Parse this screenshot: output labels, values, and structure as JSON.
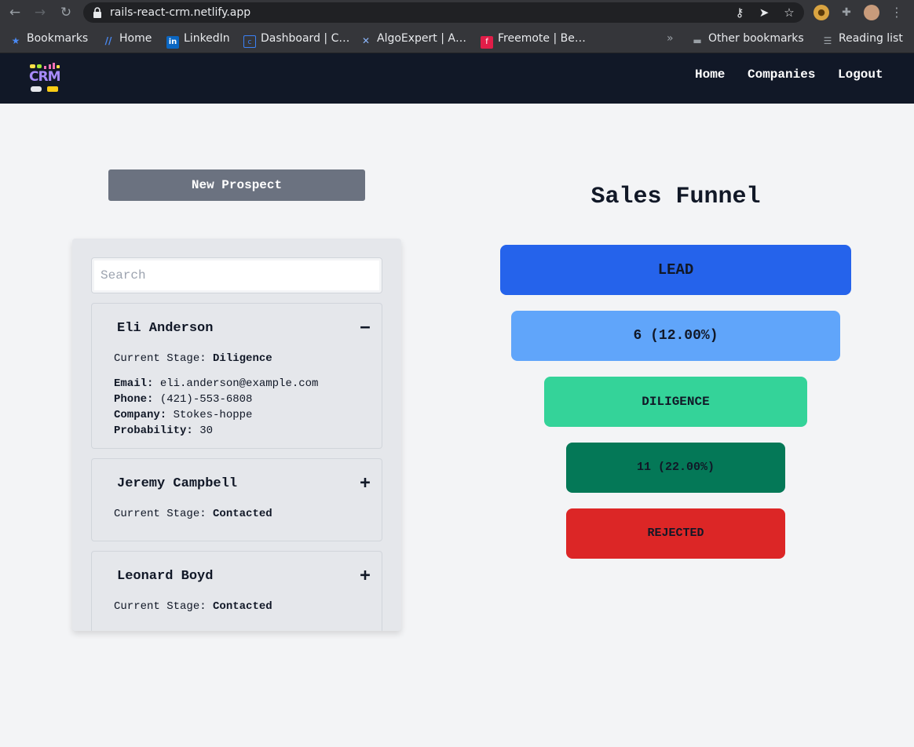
{
  "browser": {
    "url": "rails-react-crm.netlify.app",
    "bookmarks": [
      {
        "label": "Bookmarks",
        "icon": "star-icon"
      },
      {
        "label": "Home",
        "icon": "slash-icon"
      },
      {
        "label": "LinkedIn",
        "icon": "linkedin-icon"
      },
      {
        "label": "Dashboard | C…",
        "icon": "dashboard-icon"
      },
      {
        "label": "AlgoExpert | A…",
        "icon": "algoexpert-icon"
      },
      {
        "label": "Freemote | Be…",
        "icon": "freemote-icon"
      }
    ],
    "overflow": "»",
    "other_bookmarks": "Other bookmarks",
    "reading_list": "Reading list"
  },
  "app": {
    "logo_text": "CRM",
    "nav": [
      "Home",
      "Companies",
      "Logout"
    ]
  },
  "prospects": {
    "new_button": "New Prospect",
    "search_placeholder": "Search",
    "stage_label": "Current Stage:",
    "email_label": "Email:",
    "phone_label": "Phone:",
    "company_label": "Company:",
    "probability_label": "Probability:",
    "items": [
      {
        "name": "Eli Anderson",
        "toggle": "−",
        "stage": "Diligence",
        "email": "eli.anderson@example.com",
        "phone": "(421)-553-6808",
        "company": "Stokes-hoppe",
        "probability": "30"
      },
      {
        "name": "Jeremy Campbell",
        "toggle": "+",
        "stage": "Contacted"
      },
      {
        "name": "Leonard Boyd",
        "toggle": "+",
        "stage": "Contacted"
      }
    ]
  },
  "funnel": {
    "title": "Sales Funnel",
    "stages": [
      {
        "label": "LEAD",
        "color": "#2563eb"
      },
      {
        "label": "6 (12.00%)",
        "color": "#60a5fa"
      },
      {
        "label": "DILIGENCE",
        "color": "#34d399"
      },
      {
        "label": "11 (22.00%)",
        "color": "#047857"
      },
      {
        "label": "REJECTED",
        "color": "#dc2626"
      }
    ]
  }
}
